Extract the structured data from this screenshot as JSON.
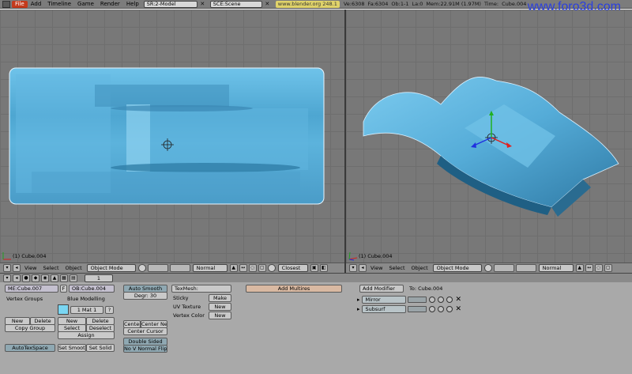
{
  "topbar": {
    "menus": [
      "File",
      "Add",
      "Timeline",
      "Game",
      "Render",
      "Help"
    ],
    "screen": "SR:2-Model",
    "scene": "SCE:Scene",
    "link": "www.blender.org 248.1",
    "stats": [
      "Ve:6308",
      "Fa:6304",
      "Ob:1-1",
      "La:0",
      "Mem:22.91M (1.97M)",
      "Time:",
      "Cube.004"
    ]
  },
  "brand": "www.foro3d.com",
  "viewport_left": {
    "label": "(1) Cube.004"
  },
  "viewport_right": {
    "label": "(1) Cube.004"
  },
  "header_left": {
    "menus": [
      "View",
      "Select",
      "Object"
    ],
    "mode": "Object Mode",
    "shading": "Normal",
    "snap": "Closest"
  },
  "header_right": {
    "menus": [
      "View",
      "Select",
      "Object"
    ],
    "mode": "Object Mode",
    "shading": "Normal"
  },
  "panel_bar": {
    "frame": "1"
  },
  "link_materials": {
    "mesh_name": "ME:Cube.007",
    "f_label": "F",
    "object_name": "OB:Cube.004",
    "vertex_groups": "Vertex Groups",
    "material_name": "Blue Modelling",
    "material_index": "1 Mat 1",
    "question": "?",
    "new": "New",
    "delete": "Delete",
    "copy_group": "Copy Group",
    "mat_new": "New",
    "mat_delete": "Delete",
    "select": "Select",
    "deselect": "Deselect",
    "assign": "Assign",
    "autotexspace": "AutoTexSpace",
    "set_smooth": "Set Smooth",
    "set_solid": "Set Solid"
  },
  "mesh": {
    "auto_smooth": "Auto Smooth",
    "degr": "Degr: 30",
    "center": "Center",
    "center_new": "Center New",
    "center_cursor": "Center Cursor",
    "double_sided": "Double Sided",
    "no_v_normal_flip": "No V Normal Flip"
  },
  "texmesh": {
    "label": "TexMesh:",
    "sticky": "Sticky",
    "sticky_btn": "Make",
    "uv_texture": "UV Texture",
    "uv_btn": "New",
    "vertex_color": "Vertex Color",
    "vc_btn": "New"
  },
  "multires": {
    "add": "Add Multires"
  },
  "modifiers": {
    "add": "Add Modifier",
    "to": "To: Cube.004",
    "items": [
      "Mirror",
      "Subsurf"
    ]
  },
  "colors": {
    "object_blue": "#5fb5dc",
    "viewport_bg": "#787878",
    "panel_bg": "#a9a9a9",
    "brand": "#2a3fe0"
  }
}
